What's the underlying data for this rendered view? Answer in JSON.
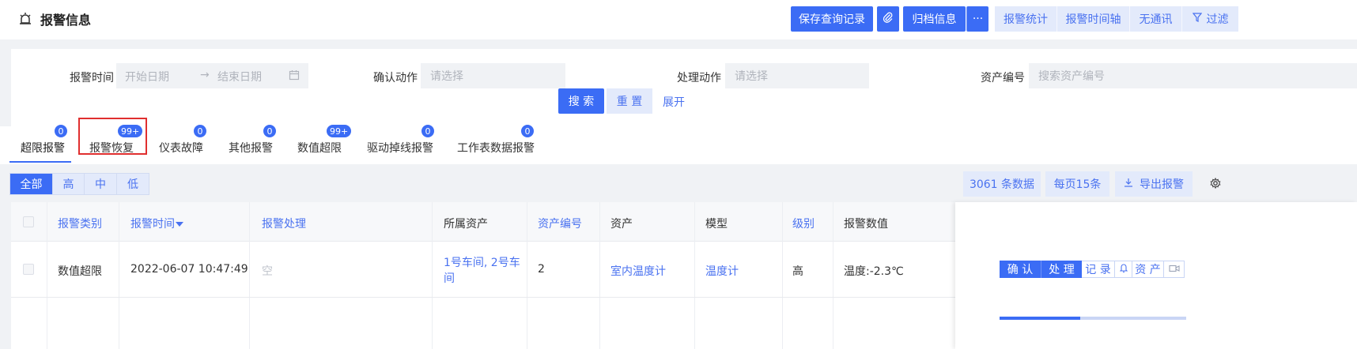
{
  "header": {
    "title": "报警信息",
    "save_query": "保存查询记录",
    "archive": "归档信息",
    "more": "···",
    "stats": "报警统计",
    "timeline": "报警时间轴",
    "no_comm": "无通讯",
    "filter": "过滤"
  },
  "search": {
    "time_label": "报警时间",
    "start_placeholder": "开始日期",
    "arrow": "→",
    "end_placeholder": "结束日期",
    "confirm_label": "确认动作",
    "confirm_placeholder": "请选择",
    "handle_label": "处理动作",
    "handle_placeholder": "请选择",
    "asset_no_label": "资产编号",
    "asset_no_placeholder": "搜索资产编号",
    "search_btn": "搜 索",
    "reset_btn": "重 置",
    "expand": "展开"
  },
  "tabs": [
    {
      "label": "超限报警",
      "badge": "0"
    },
    {
      "label": "报警恢复",
      "badge": "99+"
    },
    {
      "label": "仪表故障",
      "badge": "0"
    },
    {
      "label": "其他报警",
      "badge": "0"
    },
    {
      "label": "数值超限",
      "badge": "99+"
    },
    {
      "label": "驱动掉线报警",
      "badge": "0"
    },
    {
      "label": "工作表数据报警",
      "badge": "0"
    }
  ],
  "levels": [
    "全部",
    "高",
    "中",
    "低"
  ],
  "toolbar": {
    "count": "3061 条数据",
    "per_page": "每页15条",
    "export": "导出报警"
  },
  "table": {
    "headers": [
      "报警类别",
      "报警时间",
      "报警处理",
      "所属资产",
      "资产编号",
      "资产",
      "模型",
      "级别",
      "报警数值"
    ],
    "rows": [
      {
        "category": "数值超限",
        "time": "2022-06-07 10:47:49",
        "handling": "空",
        "asset_group_line1": "1号车间, 2号车",
        "asset_group_line2": "间",
        "asset_no": "2",
        "asset": "室内温度计",
        "model": "温度计",
        "level": "高",
        "value": "温度:-2.3℃"
      }
    ],
    "actions": {
      "confirm": "确 认",
      "handle": "处 理",
      "record": "记 录",
      "asset": "资 产"
    }
  },
  "colors": {
    "primary": "#3b6cf5",
    "light": "#e3eafb",
    "highlight": "#e02f2f"
  }
}
